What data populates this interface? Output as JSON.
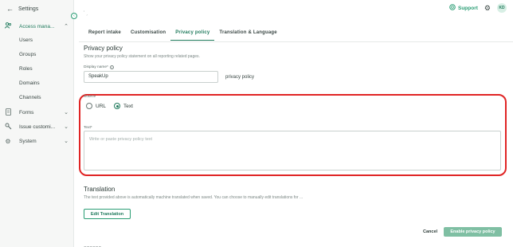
{
  "sidebar": {
    "header": "Settings",
    "items": [
      {
        "label": "Access mana...",
        "icon": "users-icon",
        "expanded": true
      },
      {
        "label": "Forms",
        "icon": "document-icon"
      },
      {
        "label": "Issue customi...",
        "icon": "tools-icon"
      },
      {
        "label": "System",
        "icon": "gear-icon"
      }
    ],
    "sub_items": [
      "Users",
      "Groups",
      "Roles",
      "Domains",
      "Channels"
    ]
  },
  "topbar": {
    "support_label": "Support",
    "avatar_initials": "KD"
  },
  "tabs": [
    {
      "label": "Report intake",
      "active": false
    },
    {
      "label": "Customisation",
      "active": false
    },
    {
      "label": "Privacy policy",
      "active": true
    },
    {
      "label": "Translation & Language",
      "active": false
    }
  ],
  "privacy": {
    "title": "Privacy policy",
    "description": "Show your privacy policy statement on all reporting related pages.",
    "display_name_label": "Display name*",
    "display_name_value": "SpeakUp",
    "display_name_suffix": "privacy policy",
    "source_label": "Source",
    "source_options": [
      "URL",
      "Text"
    ],
    "source_selected": "Text",
    "text_label": "Text*",
    "text_placeholder": "Write or paste privacy policy text"
  },
  "translation": {
    "title": "Translation",
    "description": "The text provided above is automatically machine translated when saved. You can choose to manually edit translations for ...",
    "edit_button": "Edit Translation"
  },
  "actions": {
    "cancel": "Cancel",
    "enable": "Enable privacy policy"
  },
  "colors": {
    "accent": "#1f7a5c",
    "highlight": "#e02424"
  }
}
